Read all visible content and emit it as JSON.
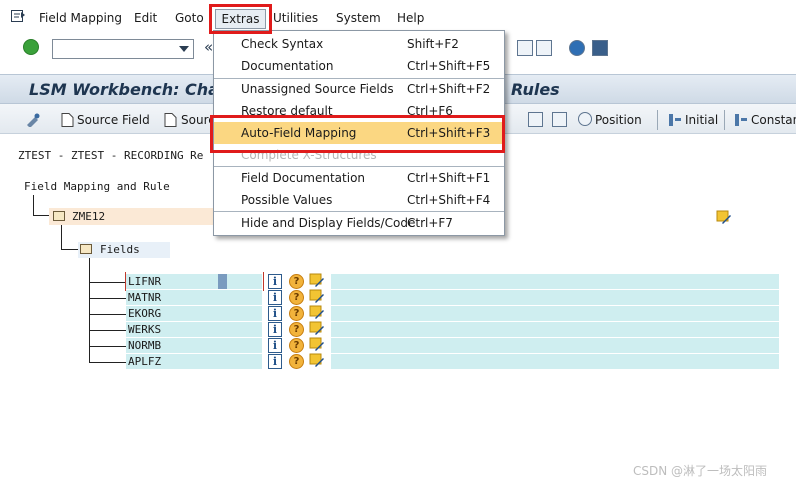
{
  "menubar": {
    "items": [
      "Field Mapping",
      "Edit",
      "Goto",
      "Extras",
      "Utilities",
      "System",
      "Help"
    ]
  },
  "toolbar": {
    "command_value": ""
  },
  "title": {
    "left": "LSM Workbench: Cha",
    "right": "Rules"
  },
  "app_toolbar": {
    "source_field": "Source Field",
    "source_field_2": "Sourc",
    "position": "Position",
    "initial": "Initial",
    "constant": "Constan"
  },
  "content": {
    "recording_line": "ZTEST - ZTEST - RECORDING Re",
    "root_label": "Field Mapping and Rule",
    "node_label": "ZME12",
    "fields_label": "Fields",
    "fields": [
      "LIFNR",
      "MATNR",
      "EKORG",
      "WERKS",
      "NORMB",
      "APLFZ"
    ]
  },
  "extras_menu": {
    "items": [
      {
        "label": "Check Syntax",
        "shortcut": "Shift+F2",
        "state": "normal"
      },
      {
        "label": "Documentation",
        "shortcut": "Ctrl+Shift+F5",
        "state": "normal"
      },
      {
        "label": "Unassigned Source Fields",
        "shortcut": "Ctrl+Shift+F2",
        "state": "normal"
      },
      {
        "label": "Restore default",
        "shortcut": "Ctrl+F6",
        "state": "normal"
      },
      {
        "label": "Auto-Field Mapping",
        "shortcut": "Ctrl+Shift+F3",
        "state": "highlighted"
      },
      {
        "label": "Complete X-Structures",
        "shortcut": "",
        "state": "disabled"
      },
      {
        "label": "Field Documentation",
        "shortcut": "Ctrl+Shift+F1",
        "state": "normal"
      },
      {
        "label": "Possible Values",
        "shortcut": "Ctrl+Shift+F4",
        "state": "normal"
      },
      {
        "label": "Hide and Display Fields/Code",
        "shortcut": "Ctrl+F7",
        "state": "normal"
      }
    ]
  },
  "watermark": "CSDN @淋了一场太阳雨",
  "colors": {
    "highlight": "#fbd782",
    "annotation_red": "#e01b1b",
    "field_bg": "#cfeef0",
    "title_text": "#1e3550"
  }
}
